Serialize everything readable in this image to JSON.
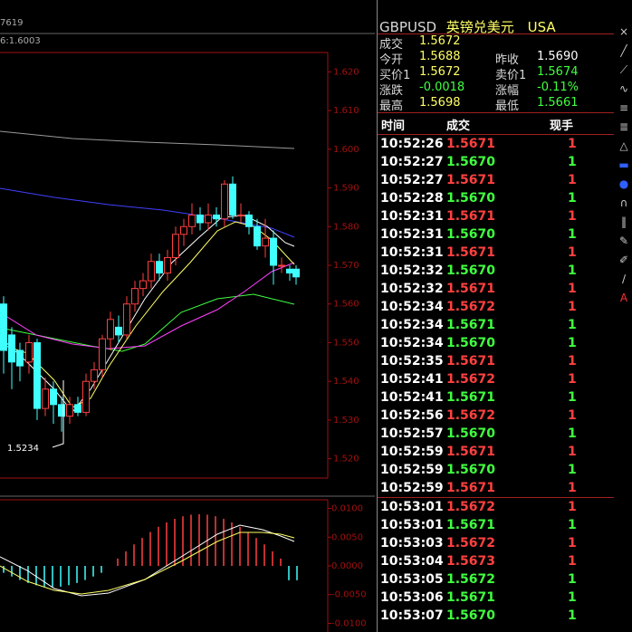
{
  "chart": {
    "header_left": "7619",
    "ma_text": "6:1.6003",
    "low_marker": "1.5234",
    "price_axis": [
      "1.620",
      "1.610",
      "1.600",
      "1.590",
      "1.580",
      "1.570",
      "1.560",
      "1.550",
      "1.540",
      "1.530",
      "1.520"
    ],
    "macd_axis": [
      "0.0100",
      "0.0050",
      "0.0000",
      "-0.0050",
      "-0.0100"
    ],
    "colors": {
      "grid": "#a01010",
      "candle_up": "#ff4040",
      "candle_down": "#40ffff",
      "ma1": "#ffffff",
      "ma2": "#ffff66",
      "ma3": "#ff40ff",
      "ma4": "#40ff40",
      "ma5": "#4040ff",
      "ma6": "#999999"
    }
  },
  "quote": {
    "symbol": "GBPUSD",
    "name_cn": "英镑兑美元",
    "market": "USA",
    "rows": [
      {
        "l1": "成交",
        "v1": "1.5672",
        "l2": "",
        "v2": ""
      },
      {
        "l1": "今开",
        "v1": "1.5688",
        "l2": "昨收",
        "v2": "1.5690"
      },
      {
        "l1": "买价1",
        "v1": "1.5672",
        "l2": "卖价1",
        "v2": "1.5674"
      },
      {
        "l1": "涨跌",
        "v1": "-0.0018",
        "l2": "涨幅",
        "v2": "-0.11%"
      },
      {
        "l1": "最高",
        "v1": "1.5698",
        "l2": "最低",
        "v2": "1.5661"
      }
    ],
    "tick_headers": {
      "time": "时间",
      "price": "成交",
      "vol": "现手"
    }
  },
  "ticks": [
    {
      "t": "10:52:26",
      "p": "1.5671",
      "v": "1",
      "d": "up"
    },
    {
      "t": "10:52:27",
      "p": "1.5670",
      "v": "1",
      "d": "dn"
    },
    {
      "t": "10:52:27",
      "p": "1.5671",
      "v": "1",
      "d": "up"
    },
    {
      "t": "10:52:28",
      "p": "1.5670",
      "v": "1",
      "d": "dn"
    },
    {
      "t": "10:52:31",
      "p": "1.5671",
      "v": "1",
      "d": "up"
    },
    {
      "t": "10:52:31",
      "p": "1.5670",
      "v": "1",
      "d": "dn"
    },
    {
      "t": "10:52:31",
      "p": "1.5671",
      "v": "1",
      "d": "up"
    },
    {
      "t": "10:52:32",
      "p": "1.5670",
      "v": "1",
      "d": "dn"
    },
    {
      "t": "10:52:32",
      "p": "1.5671",
      "v": "1",
      "d": "up"
    },
    {
      "t": "10:52:34",
      "p": "1.5672",
      "v": "1",
      "d": "up"
    },
    {
      "t": "10:52:34",
      "p": "1.5671",
      "v": "1",
      "d": "dn"
    },
    {
      "t": "10:52:34",
      "p": "1.5670",
      "v": "1",
      "d": "dn"
    },
    {
      "t": "10:52:35",
      "p": "1.5671",
      "v": "1",
      "d": "up"
    },
    {
      "t": "10:52:41",
      "p": "1.5672",
      "v": "1",
      "d": "up"
    },
    {
      "t": "10:52:41",
      "p": "1.5671",
      "v": "1",
      "d": "dn"
    },
    {
      "t": "10:52:56",
      "p": "1.5672",
      "v": "1",
      "d": "up"
    },
    {
      "t": "10:52:57",
      "p": "1.5670",
      "v": "1",
      "d": "dn"
    },
    {
      "t": "10:52:59",
      "p": "1.5671",
      "v": "1",
      "d": "up"
    },
    {
      "t": "10:52:59",
      "p": "1.5670",
      "v": "1",
      "d": "dn"
    },
    {
      "t": "10:52:59",
      "p": "1.5671",
      "v": "1",
      "d": "up"
    },
    {
      "t": "10:53:01",
      "p": "1.5672",
      "v": "1",
      "d": "up"
    },
    {
      "t": "10:53:01",
      "p": "1.5671",
      "v": "1",
      "d": "dn"
    },
    {
      "t": "10:53:03",
      "p": "1.5672",
      "v": "1",
      "d": "up"
    },
    {
      "t": "10:53:04",
      "p": "1.5673",
      "v": "1",
      "d": "up"
    },
    {
      "t": "10:53:05",
      "p": "1.5672",
      "v": "1",
      "d": "dn"
    },
    {
      "t": "10:53:06",
      "p": "1.5671",
      "v": "1",
      "d": "dn"
    },
    {
      "t": "10:53:07",
      "p": "1.5670",
      "v": "1",
      "d": "dn"
    }
  ],
  "toolbar": {
    "icons": [
      "x-icon",
      "line-icon",
      "ray-icon",
      "curve-icon",
      "hlines-icon",
      "hlines2-icon",
      "triangle-icon",
      "rect-icon",
      "ellipse-icon",
      "arc-icon",
      "vlines-icon",
      "pen-icon",
      "brush-icon",
      "ruler-icon",
      "text-tool-icon"
    ],
    "text_tool": "A"
  }
}
